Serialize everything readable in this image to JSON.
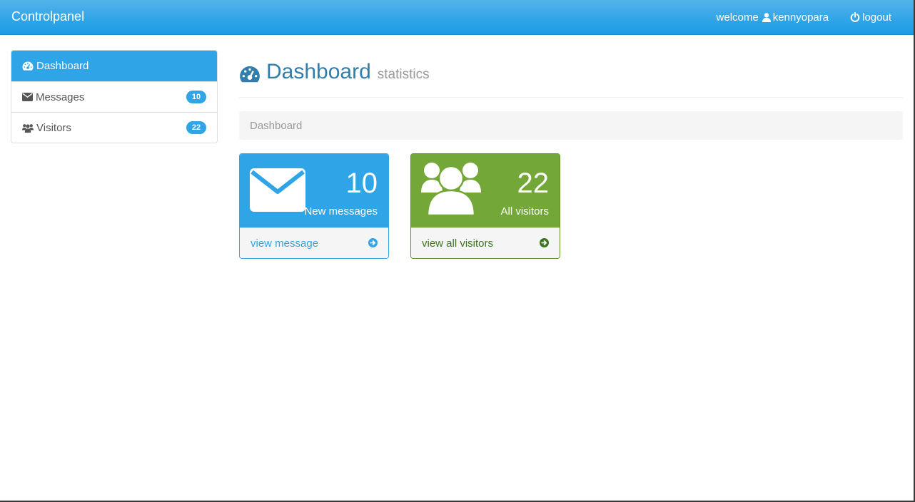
{
  "colors": {
    "primary": "#2fa4e7",
    "success": "#73a839",
    "link": "#317eac",
    "muted": "#999999"
  },
  "navbar": {
    "brand": "Controlpanel",
    "welcome_label": "welcome",
    "username": "kennyopara",
    "user_icon": "user-icon",
    "logout_label": "logout",
    "logout_icon": "power-icon"
  },
  "sidebar": {
    "items": [
      {
        "label": "Dashboard",
        "icon": "dashboard-icon",
        "badge": null,
        "active": true
      },
      {
        "label": "Messages",
        "icon": "envelope-icon",
        "badge": "10",
        "active": false
      },
      {
        "label": "Visitors",
        "icon": "users-icon",
        "badge": "22",
        "active": false
      }
    ]
  },
  "header": {
    "title": "Dashboard",
    "subtitle": "statistics",
    "icon": "dashboard-icon"
  },
  "breadcrumb": {
    "current": "Dashboard"
  },
  "panels": [
    {
      "count": "10",
      "caption": "New messages",
      "link_label": "view message",
      "icon": "envelope-icon",
      "color": "#2fa4e7"
    },
    {
      "count": "22",
      "caption": "All visitors",
      "link_label": "view all visitors",
      "icon": "users-icon",
      "color": "#73a839"
    }
  ]
}
